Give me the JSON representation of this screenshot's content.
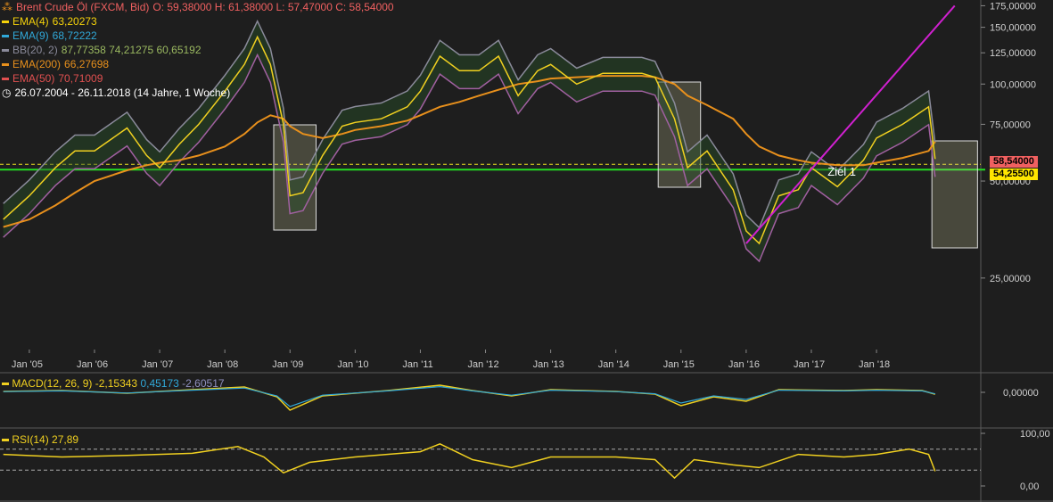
{
  "header": {
    "title": "Brent Crude Öl (FXCM, Bid)",
    "ohlc": "O: 59,38000  H: 61,38000  L: 57,47000  C: 58,54000",
    "range": "26.07.2004 - 26.11.2018   (14 Jahre, 1 Woche)"
  },
  "legend": [
    {
      "name": "EMA(4)",
      "values": "63,20273",
      "color": "#f5d20a"
    },
    {
      "name": "EMA(9)",
      "values": "68,72222",
      "color": "#30a8d8"
    },
    {
      "name": "BB(20, 2)",
      "values": "87,77358   74,21275   60,65192",
      "color": "#8a8a9a"
    },
    {
      "name": "EMA(200)",
      "values": "66,27698",
      "color": "#e8901c"
    },
    {
      "name": "EMA(50)",
      "values": "70,71009",
      "color": "#e05050"
    }
  ],
  "macd_legend": {
    "name": "MACD(12, 26, 9)",
    "v1": "-2,15343",
    "v2": "0,45173",
    "v3": "-2,60517"
  },
  "rsi_legend": {
    "name": "RSI(14)",
    "value": "27,89"
  },
  "annotation": "Ziel 1",
  "price_labels": {
    "close": "58,54000",
    "level": "54,25500"
  },
  "colors": {
    "close_tag": "#f06060",
    "level_tag": "#ffe600",
    "support": "#22dd22",
    "trend": "#d020d0",
    "price": "#f0d020",
    "macd_line": "#f0d020",
    "macd_signal": "#30a8d8",
    "rsi": "#f0d020"
  },
  "chart_data": [
    {
      "type": "line",
      "title": "Brent Crude Öl (FXCM, Bid)",
      "y_scale": "log",
      "y_ticks": [
        "175,00000",
        "150,00000",
        "125,00000",
        "100,00000",
        "75,00000",
        "50,00000",
        "25,00000"
      ],
      "x_ticks": [
        "Jan '05",
        "Jan '06",
        "Jan '07",
        "Jan '08",
        "Jan '09",
        "Jan '10",
        "Jan '11",
        "Jan '12",
        "Jan '13",
        "Jan '14",
        "Jan '15",
        "Jan '16",
        "Jan '17",
        "Jan '18"
      ],
      "x": [
        2004.6,
        2005.0,
        2005.4,
        2005.7,
        2006.0,
        2006.5,
        2006.8,
        2007.0,
        2007.3,
        2007.6,
        2008.0,
        2008.3,
        2008.5,
        2008.7,
        2008.9,
        2009.0,
        2009.2,
        2009.5,
        2009.8,
        2010.0,
        2010.4,
        2010.8,
        2011.0,
        2011.3,
        2011.6,
        2011.9,
        2012.2,
        2012.5,
        2012.8,
        2013.0,
        2013.4,
        2013.8,
        2014.0,
        2014.4,
        2014.6,
        2014.9,
        2015.1,
        2015.4,
        2015.8,
        2016.0,
        2016.2,
        2016.5,
        2016.8,
        2017.0,
        2017.4,
        2017.8,
        2018.0,
        2018.4,
        2018.8,
        2018.9
      ],
      "series": [
        {
          "name": "Brent",
          "values": [
            38,
            45,
            55,
            62,
            62,
            73,
            60,
            55,
            65,
            75,
            95,
            115,
            140,
            115,
            75,
            45,
            46,
            60,
            74,
            76,
            78,
            85,
            95,
            122,
            110,
            110,
            122,
            92,
            110,
            115,
            100,
            108,
            108,
            108,
            105,
            78,
            55,
            62,
            47,
            35,
            32,
            45,
            47,
            55,
            48,
            58,
            68,
            75,
            85,
            58.54
          ]
        },
        {
          "name": "EMA(200)",
          "values": [
            36,
            38,
            42,
            46,
            50,
            54,
            56,
            57,
            58,
            60,
            64,
            70,
            76,
            80,
            78,
            74,
            70,
            68,
            70,
            72,
            74,
            77,
            80,
            85,
            88,
            92,
            96,
            100,
            102,
            104,
            105,
            106,
            106,
            106,
            105,
            100,
            92,
            86,
            78,
            70,
            64,
            60,
            58,
            57,
            56,
            56,
            57,
            59,
            62,
            66.28
          ]
        }
      ],
      "trendline": {
        "from": [
          2016.0,
          32
        ],
        "to": [
          2019.2,
          175
        ]
      },
      "support": 54.255,
      "boxes": [
        [
          2008.75,
          2009.4
        ],
        [
          2014.65,
          2015.3
        ],
        [
          2018.85,
          2019.55
        ]
      ]
    },
    {
      "type": "bar",
      "title": "MACD(12, 26, 9)",
      "y_ticks": [
        "0,00000"
      ],
      "x": [
        2004.6,
        2005.5,
        2006.5,
        2007.5,
        2008.3,
        2008.8,
        2009.0,
        2009.5,
        2010.5,
        2011.3,
        2011.8,
        2012.4,
        2013.0,
        2014.0,
        2014.6,
        2015.0,
        2015.5,
        2016.0,
        2016.5,
        2017.5,
        2018.0,
        2018.7,
        2018.9
      ],
      "series": [
        {
          "name": "MACD",
          "values": [
            1,
            2,
            -1,
            3,
            6,
            -5,
            -20,
            -4,
            2,
            8,
            2,
            -4,
            3,
            1,
            -2,
            -15,
            -5,
            -10,
            3,
            2,
            3,
            2,
            -2.15
          ]
        }
      ]
    },
    {
      "type": "line",
      "title": "RSI(14)",
      "ylim": [
        0,
        100
      ],
      "y_ticks": [
        "100,00",
        "0,00"
      ],
      "x": [
        2004.6,
        2005.5,
        2006.5,
        2007.5,
        2008.2,
        2008.6,
        2008.9,
        2009.3,
        2010.0,
        2011.0,
        2011.3,
        2011.8,
        2012.4,
        2013.0,
        2014.0,
        2014.6,
        2014.9,
        2015.2,
        2015.8,
        2016.2,
        2016.8,
        2017.5,
        2018.0,
        2018.5,
        2018.8,
        2018.9
      ],
      "series": [
        {
          "name": "RSI",
          "values": [
            60,
            55,
            58,
            62,
            75,
            55,
            25,
            45,
            55,
            65,
            80,
            50,
            35,
            55,
            55,
            50,
            15,
            50,
            40,
            35,
            60,
            55,
            60,
            70,
            60,
            27.89
          ]
        }
      ]
    }
  ]
}
